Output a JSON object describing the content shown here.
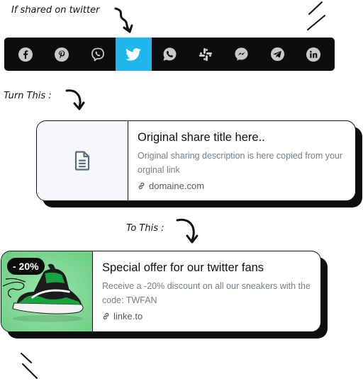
{
  "labels": {
    "if_shared": "If shared on twitter",
    "turn_this": "Turn This :",
    "to_this": "To This :"
  },
  "share_bar": {
    "active": "twitter",
    "items": [
      {
        "id": "facebook",
        "icon": "facebook-icon"
      },
      {
        "id": "pinterest",
        "icon": "pinterest-icon"
      },
      {
        "id": "viber",
        "icon": "viber-icon"
      },
      {
        "id": "twitter",
        "icon": "twitter-icon",
        "color": "#1fb6ee"
      },
      {
        "id": "whatsapp",
        "icon": "whatsapp-icon"
      },
      {
        "id": "slack",
        "icon": "slack-icon"
      },
      {
        "id": "messenger",
        "icon": "messenger-icon"
      },
      {
        "id": "telegram",
        "icon": "telegram-icon"
      },
      {
        "id": "linkedin",
        "icon": "linkedin-icon"
      }
    ]
  },
  "original_card": {
    "title": "Original share title here..",
    "description": "Original sharing description is here copied from your orginal link",
    "link": "domaine.com",
    "icon": "document-icon"
  },
  "custom_card": {
    "badge": "- 20%",
    "title": "Special offer for our twitter fans",
    "description": "Receive a -20% discount on all our sneakers with the code: TWFAN",
    "link": "linke.to",
    "image": "sneaker-image",
    "image_bg": "#78d68e"
  }
}
